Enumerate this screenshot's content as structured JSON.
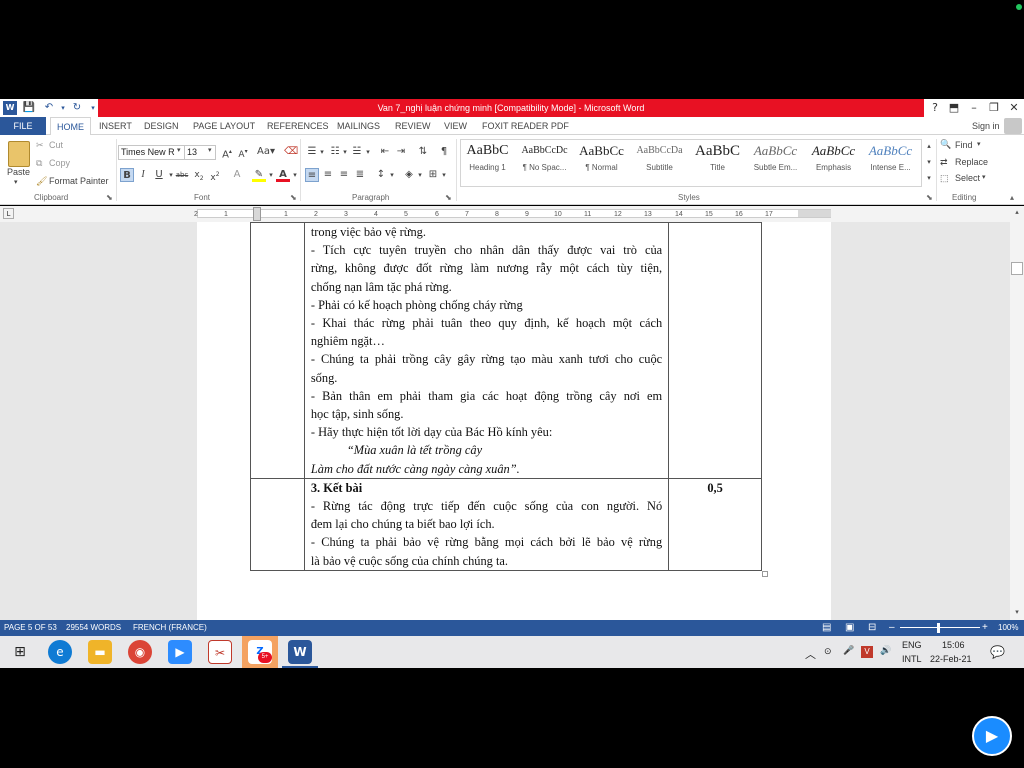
{
  "window": {
    "title": "Van 7_nghị luận chứng minh [Compatibility Mode] - Microsoft Word",
    "help": "?",
    "sign_in": "Sign in"
  },
  "ribbon_tabs": [
    "FILE",
    "HOME",
    "INSERT",
    "DESIGN",
    "PAGE LAYOUT",
    "REFERENCES",
    "MAILINGS",
    "REVIEW",
    "VIEW",
    "FOXIT READER PDF"
  ],
  "clipboard": {
    "paste": "Paste",
    "cut": "Cut",
    "copy": "Copy",
    "format_painter": "Format Painter",
    "group": "Clipboard"
  },
  "font": {
    "name": "Times New R",
    "size": "13",
    "group": "Font"
  },
  "paragraph": {
    "group": "Paragraph"
  },
  "styles": {
    "group": "Styles",
    "items": [
      {
        "sample": "AaBbC",
        "name": "Heading 1"
      },
      {
        "sample": "AaBbCcDc",
        "name": "¶ No Spac..."
      },
      {
        "sample": "AaBbCc",
        "name": "¶ Normal"
      },
      {
        "sample": "AaBbCcDa",
        "name": "Subtitle"
      },
      {
        "sample": "AaBbC",
        "name": "Title"
      },
      {
        "sample": "AaBbCc",
        "name": "Subtle Em..."
      },
      {
        "sample": "AaBbCc",
        "name": "Emphasis"
      },
      {
        "sample": "AaBbCc",
        "name": "Intense E..."
      }
    ]
  },
  "editing": {
    "group": "Editing",
    "find": "Find",
    "replace": "Replace",
    "select": "Select"
  },
  "ruler": {
    "left_marker": "L",
    "ticks": [
      "2",
      "1",
      "1",
      "2",
      "3",
      "4",
      "5",
      "6",
      "7",
      "8",
      "9",
      "10",
      "11",
      "12",
      "13",
      "14",
      "15",
      "16",
      "17"
    ]
  },
  "document": {
    "row1_lines": [
      "trong việc bảo vệ rừng.",
      "- Tích cực tuyên truyền cho nhân dân thấy được vai trò của",
      "rừng, không được đốt rừng làm nương rẫy một cách tùy tiện,",
      "chống nạn lâm tặc phá rừng.",
      "-  Phải có kế hoạch phòng chống cháy rừng",
      "- Khai thác rừng phải tuân theo quy định, kế hoạch một cách",
      "nghiêm ngặt…",
      "- Chúng ta phải trồng cây gây rừng tạo màu xanh tươi cho cuộc",
      "sống.",
      "- Bản thân em phải tham gia các hoạt động trồng cây nơi em",
      "học tập, sinh sống.",
      "- Hãy thực hiện tốt lời dạy của Bác Hồ kính yêu:"
    ],
    "quote_line1": "“Mùa xuân là tết trồng cây",
    "quote_line2": "Làm cho đất nước càng ngày càng xuân”.",
    "section_title": "3. Kết bài",
    "section_score": "0,5",
    "row2_lines": [
      "- Rừng tác động trực tiếp đến cuộc sống của con người. Nó",
      "đem lại cho chúng ta biết bao lợi ích.",
      "- Chúng ta phải bảo vệ rừng bằng mọi cách bởi lẽ bảo vệ rừng",
      "là bảo vệ cuộc sống của chính chúng ta."
    ]
  },
  "status": {
    "page": "PAGE 5 OF 53",
    "words": "29554 WORDS",
    "language": "FRENCH (FRANCE)",
    "zoom": "100%"
  },
  "taskbar": {
    "lang1": "ENG",
    "lang2": "INTL",
    "time": "15:06",
    "date": "22-Feb-21",
    "badge": "5+"
  }
}
